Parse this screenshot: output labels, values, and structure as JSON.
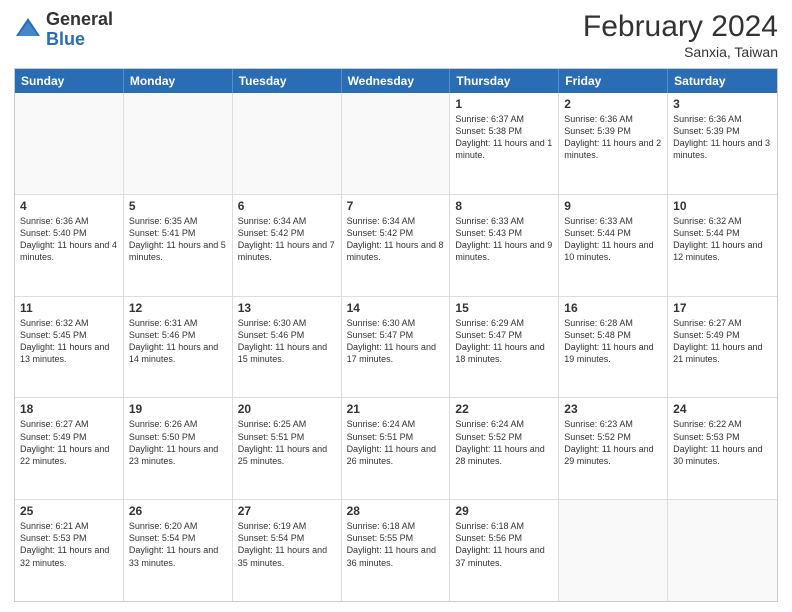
{
  "header": {
    "logo_general": "General",
    "logo_blue": "Blue",
    "month_title": "February 2024",
    "subtitle": "Sanxia, Taiwan"
  },
  "days_of_week": [
    "Sunday",
    "Monday",
    "Tuesday",
    "Wednesday",
    "Thursday",
    "Friday",
    "Saturday"
  ],
  "weeks": [
    [
      {
        "day": "",
        "info": "",
        "empty": true
      },
      {
        "day": "",
        "info": "",
        "empty": true
      },
      {
        "day": "",
        "info": "",
        "empty": true
      },
      {
        "day": "",
        "info": "",
        "empty": true
      },
      {
        "day": "1",
        "info": "Sunrise: 6:37 AM\nSunset: 5:38 PM\nDaylight: 11 hours and 1 minute."
      },
      {
        "day": "2",
        "info": "Sunrise: 6:36 AM\nSunset: 5:39 PM\nDaylight: 11 hours and 2 minutes."
      },
      {
        "day": "3",
        "info": "Sunrise: 6:36 AM\nSunset: 5:39 PM\nDaylight: 11 hours and 3 minutes."
      }
    ],
    [
      {
        "day": "4",
        "info": "Sunrise: 6:36 AM\nSunset: 5:40 PM\nDaylight: 11 hours and 4 minutes."
      },
      {
        "day": "5",
        "info": "Sunrise: 6:35 AM\nSunset: 5:41 PM\nDaylight: 11 hours and 5 minutes."
      },
      {
        "day": "6",
        "info": "Sunrise: 6:34 AM\nSunset: 5:42 PM\nDaylight: 11 hours and 7 minutes."
      },
      {
        "day": "7",
        "info": "Sunrise: 6:34 AM\nSunset: 5:42 PM\nDaylight: 11 hours and 8 minutes."
      },
      {
        "day": "8",
        "info": "Sunrise: 6:33 AM\nSunset: 5:43 PM\nDaylight: 11 hours and 9 minutes."
      },
      {
        "day": "9",
        "info": "Sunrise: 6:33 AM\nSunset: 5:44 PM\nDaylight: 11 hours and 10 minutes."
      },
      {
        "day": "10",
        "info": "Sunrise: 6:32 AM\nSunset: 5:44 PM\nDaylight: 11 hours and 12 minutes."
      }
    ],
    [
      {
        "day": "11",
        "info": "Sunrise: 6:32 AM\nSunset: 5:45 PM\nDaylight: 11 hours and 13 minutes."
      },
      {
        "day": "12",
        "info": "Sunrise: 6:31 AM\nSunset: 5:46 PM\nDaylight: 11 hours and 14 minutes."
      },
      {
        "day": "13",
        "info": "Sunrise: 6:30 AM\nSunset: 5:46 PM\nDaylight: 11 hours and 15 minutes."
      },
      {
        "day": "14",
        "info": "Sunrise: 6:30 AM\nSunset: 5:47 PM\nDaylight: 11 hours and 17 minutes."
      },
      {
        "day": "15",
        "info": "Sunrise: 6:29 AM\nSunset: 5:47 PM\nDaylight: 11 hours and 18 minutes."
      },
      {
        "day": "16",
        "info": "Sunrise: 6:28 AM\nSunset: 5:48 PM\nDaylight: 11 hours and 19 minutes."
      },
      {
        "day": "17",
        "info": "Sunrise: 6:27 AM\nSunset: 5:49 PM\nDaylight: 11 hours and 21 minutes."
      }
    ],
    [
      {
        "day": "18",
        "info": "Sunrise: 6:27 AM\nSunset: 5:49 PM\nDaylight: 11 hours and 22 minutes."
      },
      {
        "day": "19",
        "info": "Sunrise: 6:26 AM\nSunset: 5:50 PM\nDaylight: 11 hours and 23 minutes."
      },
      {
        "day": "20",
        "info": "Sunrise: 6:25 AM\nSunset: 5:51 PM\nDaylight: 11 hours and 25 minutes."
      },
      {
        "day": "21",
        "info": "Sunrise: 6:24 AM\nSunset: 5:51 PM\nDaylight: 11 hours and 26 minutes."
      },
      {
        "day": "22",
        "info": "Sunrise: 6:24 AM\nSunset: 5:52 PM\nDaylight: 11 hours and 28 minutes."
      },
      {
        "day": "23",
        "info": "Sunrise: 6:23 AM\nSunset: 5:52 PM\nDaylight: 11 hours and 29 minutes."
      },
      {
        "day": "24",
        "info": "Sunrise: 6:22 AM\nSunset: 5:53 PM\nDaylight: 11 hours and 30 minutes."
      }
    ],
    [
      {
        "day": "25",
        "info": "Sunrise: 6:21 AM\nSunset: 5:53 PM\nDaylight: 11 hours and 32 minutes."
      },
      {
        "day": "26",
        "info": "Sunrise: 6:20 AM\nSunset: 5:54 PM\nDaylight: 11 hours and 33 minutes."
      },
      {
        "day": "27",
        "info": "Sunrise: 6:19 AM\nSunset: 5:54 PM\nDaylight: 11 hours and 35 minutes."
      },
      {
        "day": "28",
        "info": "Sunrise: 6:18 AM\nSunset: 5:55 PM\nDaylight: 11 hours and 36 minutes."
      },
      {
        "day": "29",
        "info": "Sunrise: 6:18 AM\nSunset: 5:56 PM\nDaylight: 11 hours and 37 minutes."
      },
      {
        "day": "",
        "info": "",
        "empty": true
      },
      {
        "day": "",
        "info": "",
        "empty": true
      }
    ]
  ]
}
